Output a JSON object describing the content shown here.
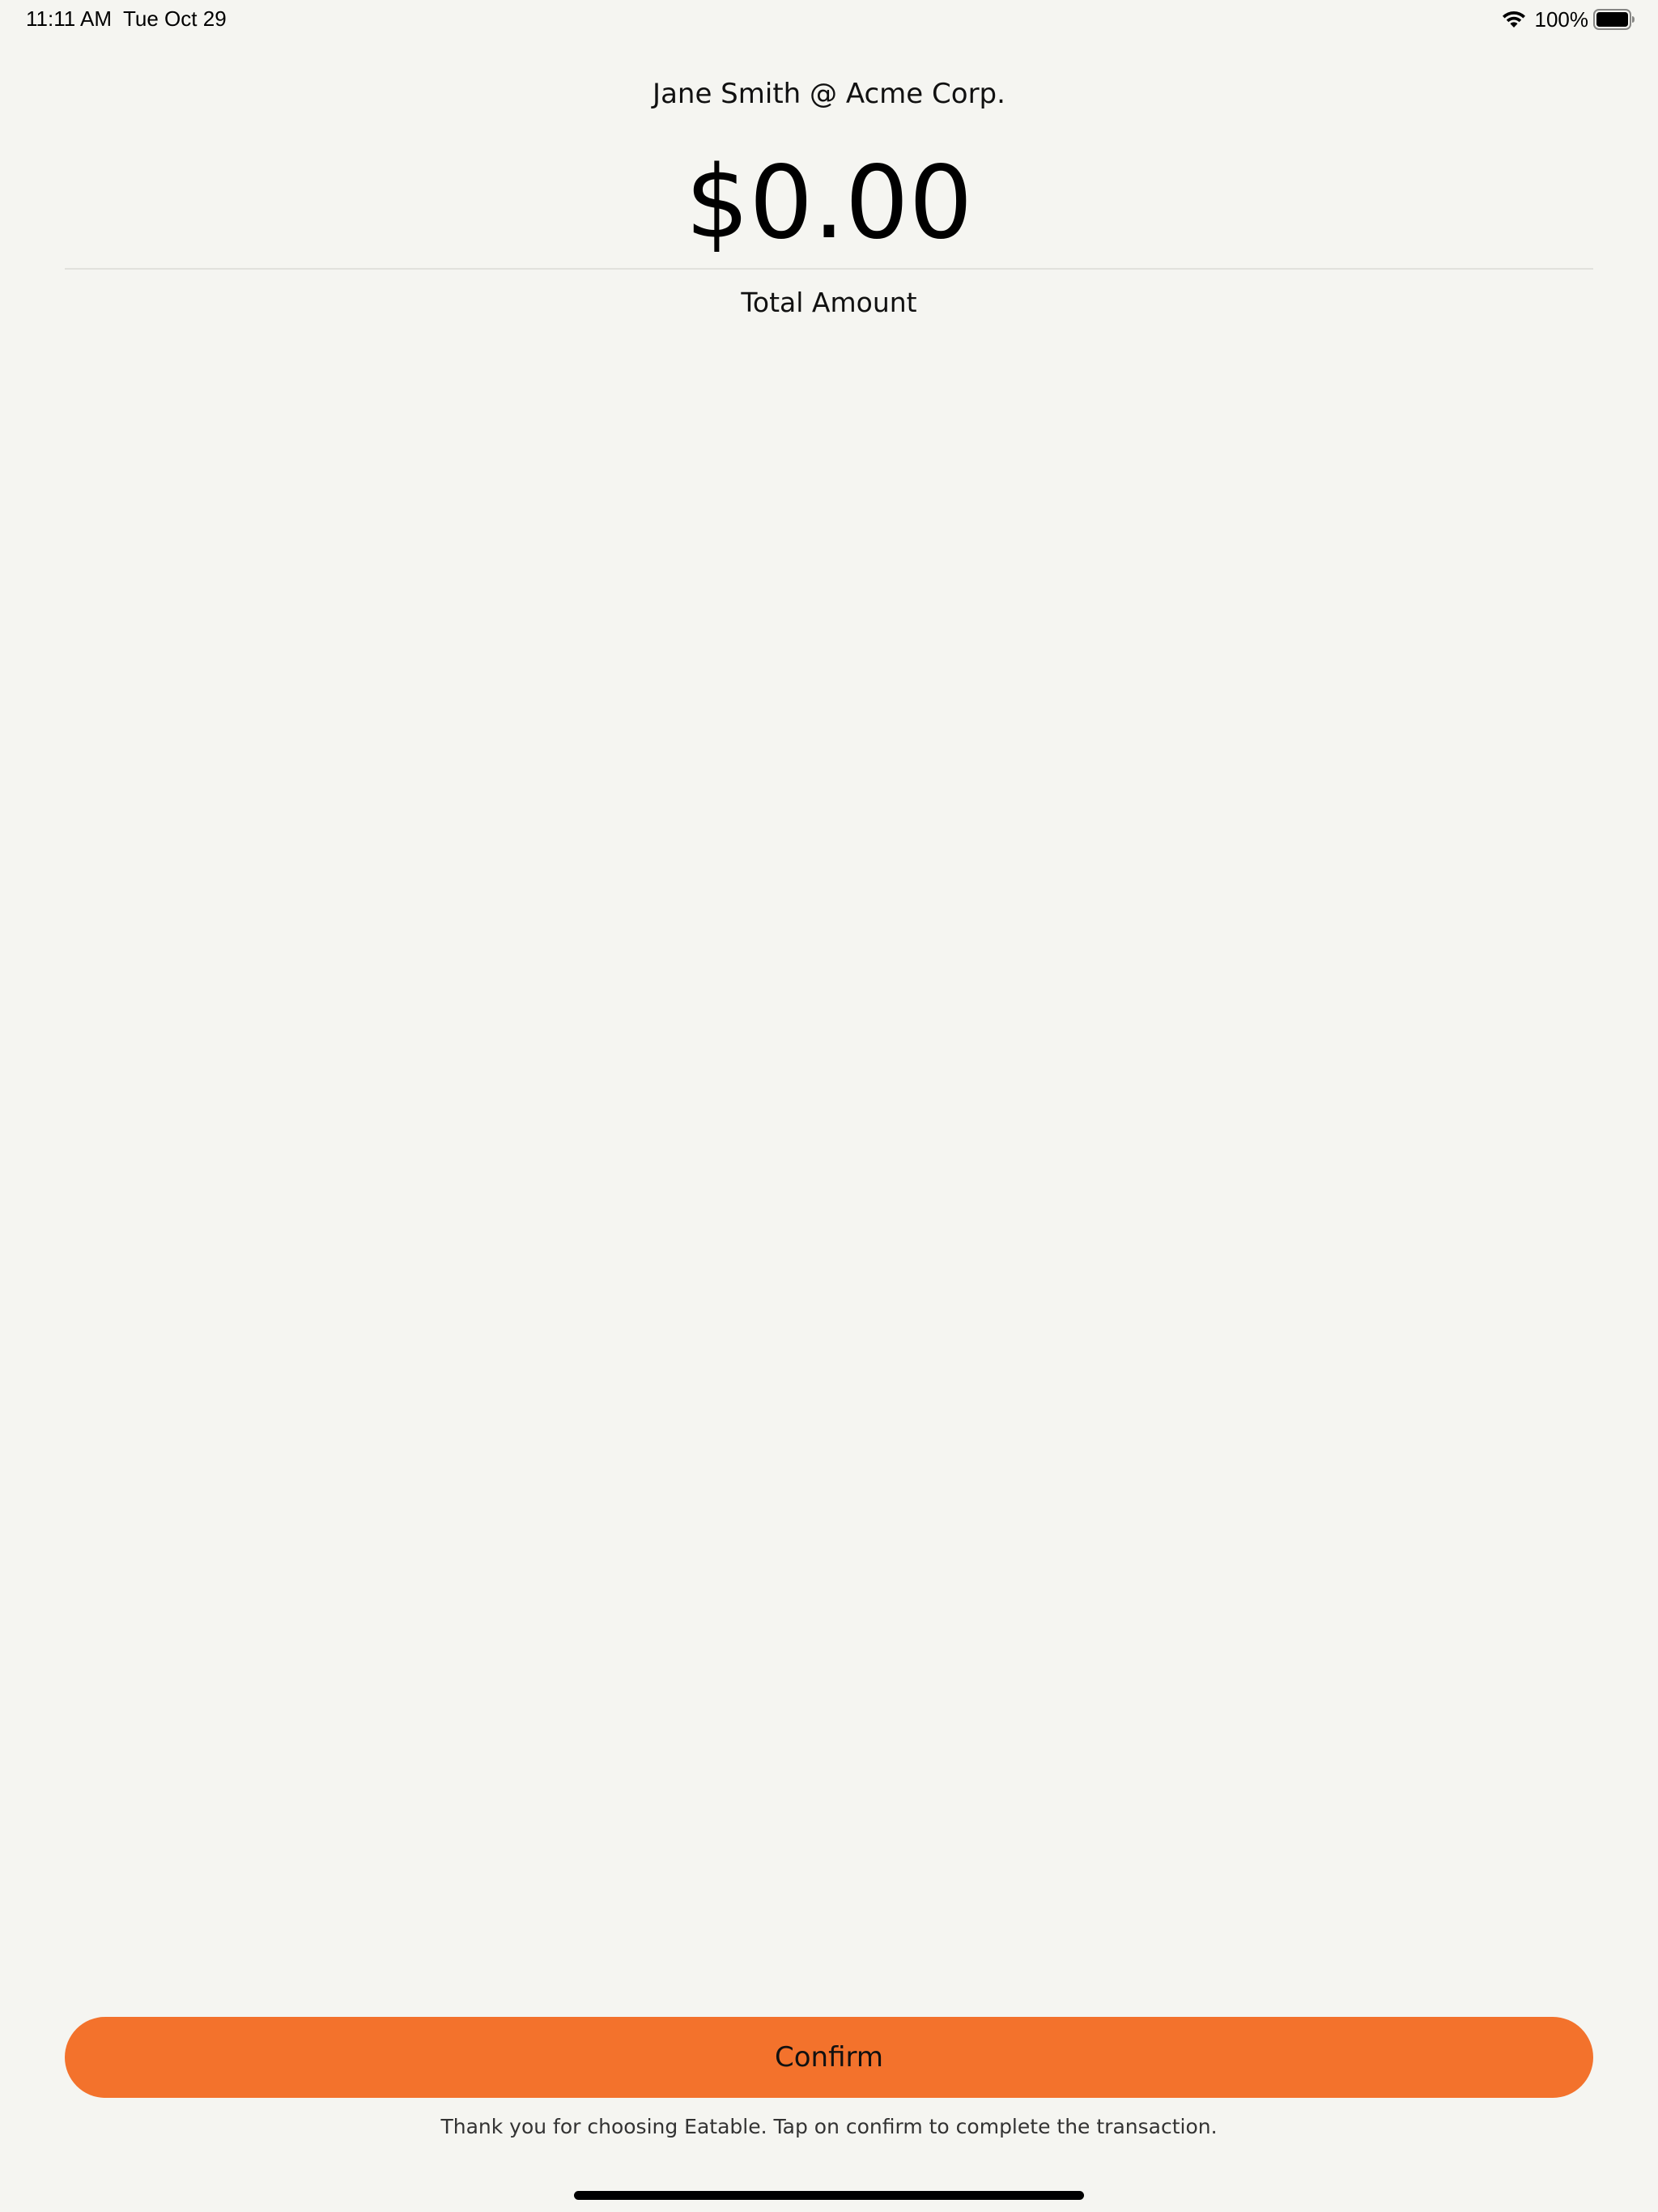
{
  "status_bar": {
    "time": "11:11 AM",
    "date": "Tue Oct 29",
    "battery_percent": "100%",
    "battery_level": 1.0,
    "icons": [
      "wifi-icon",
      "battery-icon"
    ]
  },
  "header": {
    "customer": "Jane Smith @ Acme Corp."
  },
  "summary": {
    "total_value": "$0.00",
    "total_label": "Total Amount"
  },
  "actions": {
    "confirm_label": "Confirm"
  },
  "footer": {
    "note": "Thank you for choosing Eatable. Tap on confirm to complete the transaction."
  },
  "colors": {
    "background": "#f5f5f1",
    "accent": "#f3722c"
  }
}
